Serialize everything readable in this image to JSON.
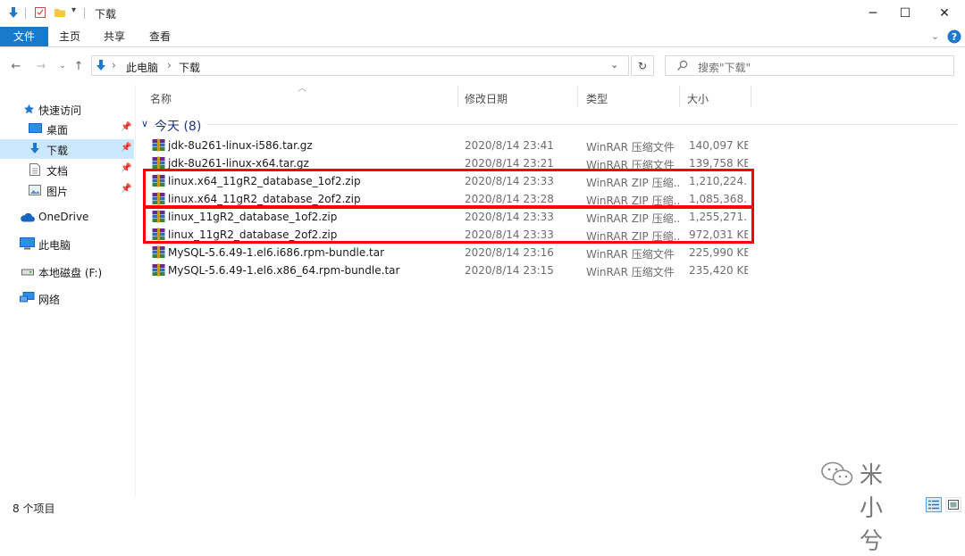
{
  "window": {
    "title": "下载",
    "controls": {
      "minimize": "─",
      "maximize": "☐",
      "close": "✕"
    }
  },
  "ribbon": {
    "tabs": [
      {
        "label": "文件",
        "active": true
      },
      {
        "label": "主页"
      },
      {
        "label": "共享"
      },
      {
        "label": "查看"
      }
    ],
    "accent": "#1979ca"
  },
  "address": {
    "breadcrumb": [
      "此电脑",
      "下载"
    ],
    "separator": "›",
    "search_placeholder": "搜索\"下载\""
  },
  "nav_pane": {
    "items": [
      {
        "label": "快速访问",
        "icon": "star-icon"
      },
      {
        "label": "桌面",
        "icon": "desktop-icon",
        "pinned": true
      },
      {
        "label": "下载",
        "icon": "download-icon",
        "pinned": true,
        "selected": true
      },
      {
        "label": "文档",
        "icon": "document-icon",
        "pinned": true
      },
      {
        "label": "图片",
        "icon": "pictures-icon",
        "pinned": true
      },
      {
        "label": "OneDrive",
        "icon": "cloud-icon"
      },
      {
        "label": "此电脑",
        "icon": "computer-icon"
      },
      {
        "label": "本地磁盘 (F:)",
        "icon": "drive-icon"
      },
      {
        "label": "网络",
        "icon": "network-icon"
      }
    ]
  },
  "columns": {
    "name": "名称",
    "date": "修改日期",
    "type": "类型",
    "size": "大小"
  },
  "group": {
    "label": "今天 (8)"
  },
  "files": [
    {
      "name": "jdk-8u261-linux-i586.tar.gz",
      "date": "2020/8/14 23:41",
      "type": "WinRAR 压缩文件",
      "size": "140,097 KB"
    },
    {
      "name": "jdk-8u261-linux-x64.tar.gz",
      "date": "2020/8/14 23:21",
      "type": "WinRAR 压缩文件",
      "size": "139,758 KB"
    },
    {
      "name": "linux.x64_11gR2_database_1of2.zip",
      "date": "2020/8/14 23:33",
      "type": "WinRAR ZIP 压缩...",
      "size": "1,210,224..."
    },
    {
      "name": "linux.x64_11gR2_database_2of2.zip",
      "date": "2020/8/14 23:28",
      "type": "WinRAR ZIP 压缩...",
      "size": "1,085,368..."
    },
    {
      "name": "linux_11gR2_database_1of2.zip",
      "date": "2020/8/14 23:33",
      "type": "WinRAR ZIP 压缩...",
      "size": "1,255,271..."
    },
    {
      "name": "linux_11gR2_database_2of2.zip",
      "date": "2020/8/14 23:33",
      "type": "WinRAR ZIP 压缩...",
      "size": "972,031 KB"
    },
    {
      "name": "MySQL-5.6.49-1.el6.i686.rpm-bundle.tar",
      "date": "2020/8/14 23:16",
      "type": "WinRAR 压缩文件",
      "size": "225,990 KB"
    },
    {
      "name": "MySQL-5.6.49-1.el6.x86_64.rpm-bundle.tar",
      "date": "2020/8/14 23:15",
      "type": "WinRAR 压缩文件",
      "size": "235,420 KB"
    }
  ],
  "status": {
    "count": "8 个项目"
  },
  "watermark": "米小兮",
  "highlight_color": "#ff0000"
}
